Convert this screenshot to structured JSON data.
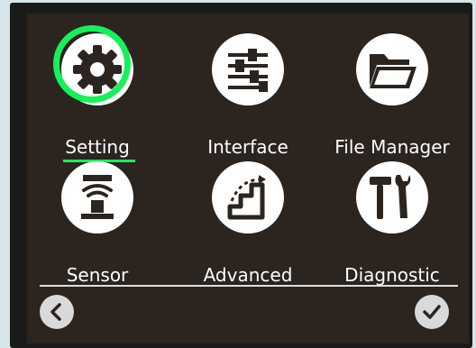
{
  "menu": {
    "items": [
      {
        "label": "Setting",
        "icon": "gear-icon",
        "selected": true
      },
      {
        "label": "Interface",
        "icon": "sliders-icon",
        "selected": false
      },
      {
        "label": "File Manager",
        "icon": "folder-icon",
        "selected": false
      },
      {
        "label": "Sensor",
        "icon": "sensor-icon",
        "selected": false
      },
      {
        "label": "Advanced",
        "icon": "stairs-icon",
        "selected": false
      },
      {
        "label": "Diagnostic",
        "icon": "tools-icon",
        "selected": false
      }
    ]
  },
  "colors": {
    "background": "#2b241f",
    "accent": "#16f05a",
    "icon_bg": "#ffffff",
    "text": "#ffffff"
  },
  "footer": {
    "back_icon": "chevron-left-icon",
    "confirm_icon": "check-icon"
  }
}
